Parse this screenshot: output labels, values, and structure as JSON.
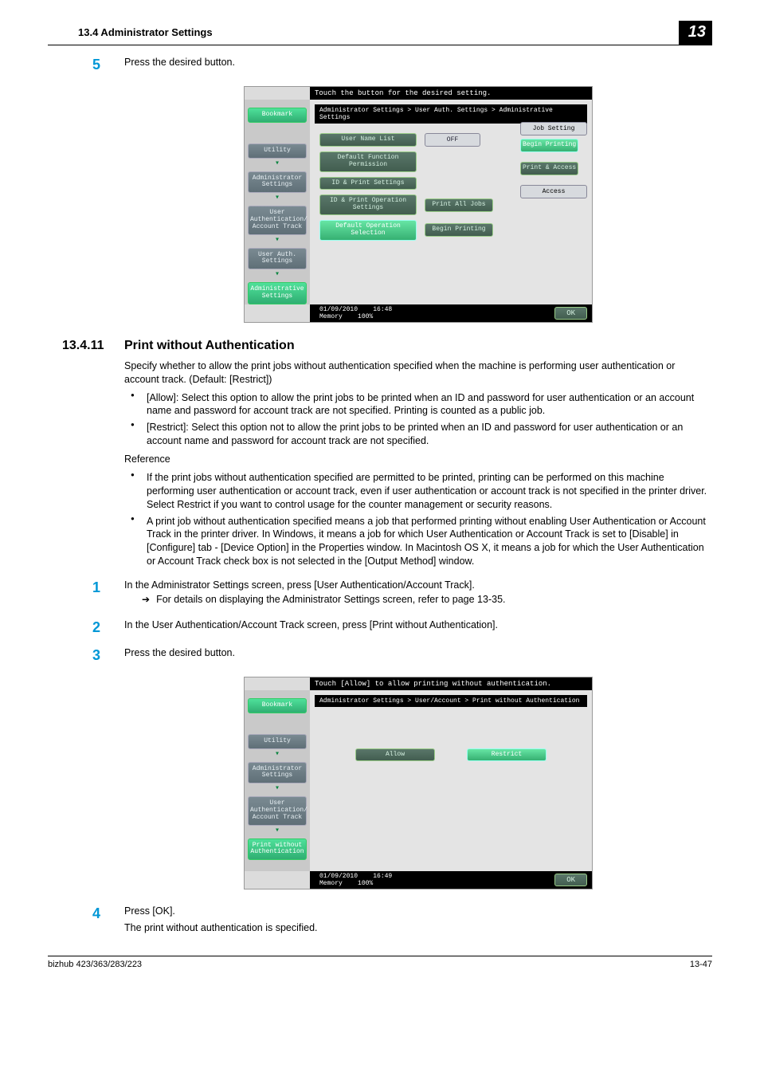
{
  "header": {
    "left": "13.4    Administrator Settings",
    "badge": "13"
  },
  "step5": {
    "num": "5",
    "text": "Press the desired button."
  },
  "screenshot1": {
    "top": "Touch the button for the desired setting.",
    "breadcrumb": "Administrator Settings > User Auth. Settings > Administrative Settings",
    "side": {
      "bookmark": "Bookmark",
      "utility": "Utility",
      "admin": "Administrator Settings",
      "userauth": "User Authentication/ Account Track",
      "uasettings": "User Auth. Settings",
      "adminset": "Administrative Settings"
    },
    "rows": {
      "r1a": "User Name List",
      "r1b": "OFF",
      "r2": "Default Function Permission",
      "r3": "ID & Print Settings",
      "r4a": "ID & Print Operation Settings",
      "r4b": "Print All Jobs",
      "r5a": "Default Operation Selection",
      "r5b": "Begin Printing"
    },
    "right": {
      "jobsetting": "Job Setting",
      "begin": "Begin Printing",
      "printaccess": "Print & Access",
      "access": "Access"
    },
    "footer": {
      "date": "01/09/2010",
      "time": "16:48",
      "mem": "Memory",
      "pct": "100%",
      "ok": "OK"
    }
  },
  "section": {
    "num": "13.4.11",
    "title": "Print without Authentication",
    "intro": "Specify whether to allow the print jobs without authentication specified when the machine is performing user authentication or account track. (Default: [Restrict])",
    "li1": "[Allow]: Select this option to allow the print jobs to be printed when an ID and password for user authentication or an account name and password for account track are not specified. Printing is counted as a public job.",
    "li2": "[Restrict]: Select this option not to allow the print jobs to be printed when an ID and password for user authentication or an account name and password for account track are not specified.",
    "refhead": "Reference",
    "ref1": "If the print jobs without authentication specified are permitted to be printed, printing can be performed on this machine performing user authentication or account track, even if user authentication or account track is not specified in the printer driver. Select Restrict if you want to control usage for the counter management or security reasons.",
    "ref2": "A print job without authentication specified means a job that performed printing without enabling User Authentication or Account Track in the printer driver. In Windows, it means a job for which User Authentication or Account Track is set to [Disable] in [Configure] tab - [Device Option] in the Properties window. In Macintosh OS X, it means a job for which the User Authentication or Account Track check box is not selected in the [Output Method] window."
  },
  "steps": {
    "s1": {
      "num": "1",
      "text": "In the Administrator Settings screen, press [User Authentication/Account Track].",
      "sub": "For details on displaying the Administrator Settings screen, refer to page 13-35."
    },
    "s2": {
      "num": "2",
      "text": "In the User Authentication/Account Track screen, press [Print without Authentication]."
    },
    "s3": {
      "num": "3",
      "text": "Press the desired button."
    }
  },
  "screenshot2": {
    "top": "Touch [Allow] to allow printing without authentication.",
    "breadcrumb": "Administrator Settings > User/Account > Print without Authentication",
    "side": {
      "bookmark": "Bookmark",
      "utility": "Utility",
      "admin": "Administrator Settings",
      "userauth": "User Authentication/ Account Track",
      "pwa": "Print without Authentication"
    },
    "allow": "Allow",
    "restrict": "Restrict",
    "footer": {
      "date": "01/09/2010",
      "time": "16:49",
      "mem": "Memory",
      "pct": "100%",
      "ok": "OK"
    }
  },
  "step4": {
    "num": "4",
    "text": "Press [OK].",
    "after": "The print without authentication is specified."
  },
  "footer": {
    "left": "bizhub 423/363/283/223",
    "right": "13-47"
  }
}
